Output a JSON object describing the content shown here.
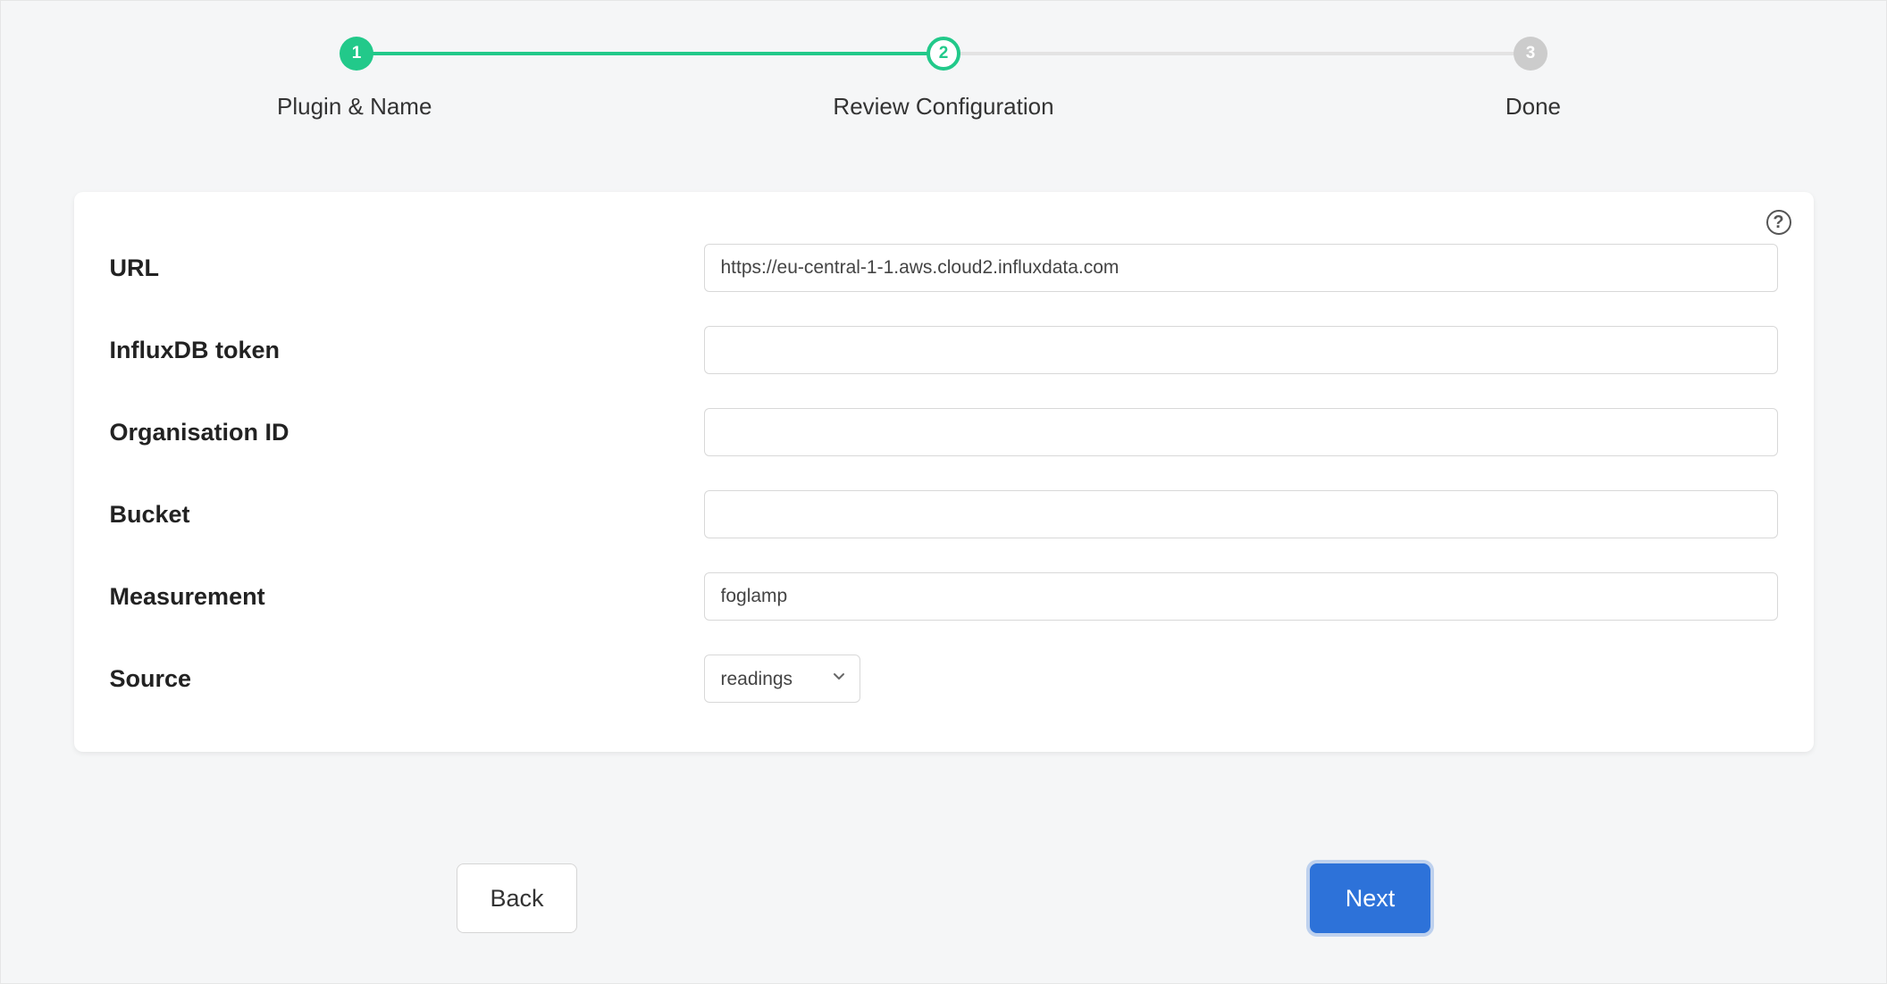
{
  "stepper": {
    "steps": [
      {
        "num": "1",
        "label": "Plugin & Name"
      },
      {
        "num": "2",
        "label": "Review Configuration"
      },
      {
        "num": "3",
        "label": "Done"
      }
    ]
  },
  "form": {
    "url": {
      "label": "URL",
      "value": "https://eu-central-1-1.aws.cloud2.influxdata.com"
    },
    "token": {
      "label": "InfluxDB token",
      "value": ""
    },
    "org": {
      "label": "Organisation ID",
      "value": ""
    },
    "bucket": {
      "label": "Bucket",
      "value": ""
    },
    "measurement": {
      "label": "Measurement",
      "value": "foglamp"
    },
    "source": {
      "label": "Source",
      "value": "readings"
    }
  },
  "buttons": {
    "back": "Back",
    "next": "Next"
  },
  "help_tooltip": "?"
}
